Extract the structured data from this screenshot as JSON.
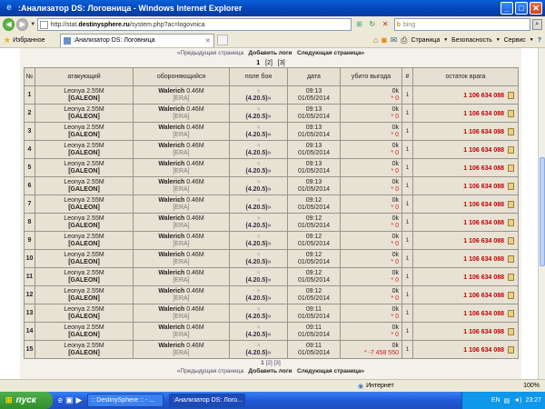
{
  "window": {
    "title": ":Анализатор DS: Логовница - Windows Internet Explorer",
    "min": "_",
    "max": "□",
    "close": "✕"
  },
  "address": {
    "prefix": "http://stat.",
    "domain": "destinysphere.ru",
    "path": "/system.php?ac=logovnica",
    "search_placeholder": "bing"
  },
  "favorites": {
    "label": "Избранное"
  },
  "tab": {
    "label": ":Анализатор DS: Логовница"
  },
  "commands": {
    "page": "Страница",
    "safety": "Безопасность",
    "service": "Сервис",
    "help": "?"
  },
  "pager": {
    "prev": "«Предыдущая страница",
    "add": "Добавить логи",
    "next": "Следующая страница»",
    "pages": [
      "1",
      "[2]",
      "[3]"
    ]
  },
  "table": {
    "headers": [
      "№",
      "атакующий",
      "обороняющийся",
      "поле боя",
      "дата",
      "убито выгода",
      "#",
      "остаток врага"
    ],
    "rows": [
      {
        "n": "1",
        "att": "Leonya 2.55M",
        "att_corp": "[GALEON]",
        "def": "Walerich",
        "def_val": "0.46M",
        "def_corp": "[ERA]",
        "field": "(4.20.5)",
        "time": "09:13",
        "date": "01/05/2014",
        "kill": "0k",
        "gain": "0",
        "hash": "1",
        "rest": "1 106 634 088"
      },
      {
        "n": "2",
        "att": "Leonya 2.55M",
        "att_corp": "[GALEON]",
        "def": "Walerich",
        "def_val": "0.46M",
        "def_corp": "[ERA]",
        "field": "(4.20.5)",
        "time": "09:13",
        "date": "01/05/2014",
        "kill": "0k",
        "gain": "0",
        "hash": "1",
        "rest": "1 106 634 088"
      },
      {
        "n": "3",
        "att": "Leonya 2.55M",
        "att_corp": "[GALEON]",
        "def": "Walerich",
        "def_val": "0.46M",
        "def_corp": "[ERA]",
        "field": "(4.20.5)",
        "time": "09:13",
        "date": "01/05/2014",
        "kill": "0k",
        "gain": "0",
        "hash": "1",
        "rest": "1 106 634 088"
      },
      {
        "n": "4",
        "att": "Leonya 2.55M",
        "att_corp": "[GALEON]",
        "def": "Walerich",
        "def_val": "0.46M",
        "def_corp": "[ERA]",
        "field": "(4.20.5)",
        "time": "09:13",
        "date": "01/05/2014",
        "kill": "0k",
        "gain": "0",
        "hash": "1",
        "rest": "1 106 634 088"
      },
      {
        "n": "5",
        "att": "Leonya 2.55M",
        "att_corp": "[GALEON]",
        "def": "Walerich",
        "def_val": "0.46M",
        "def_corp": "[ERA]",
        "field": "(4.20.5)",
        "time": "09:13",
        "date": "01/05/2014",
        "kill": "0k",
        "gain": "0",
        "hash": "1",
        "rest": "1 106 634 088"
      },
      {
        "n": "6",
        "att": "Leonya 2.55M",
        "att_corp": "[GALEON]",
        "def": "Walerich",
        "def_val": "0.46M",
        "def_corp": "[ERA]",
        "field": "(4.20.5)",
        "time": "09:13",
        "date": "01/05/2014",
        "kill": "0k",
        "gain": "0",
        "hash": "1",
        "rest": "1 106 634 088"
      },
      {
        "n": "7",
        "att": "Leonya 2.55M",
        "att_corp": "[GALEON]",
        "def": "Walerich",
        "def_val": "0.46M",
        "def_corp": "[ERA]",
        "field": "(4.20.5)",
        "time": "09:12",
        "date": "01/05/2014",
        "kill": "0k",
        "gain": "0",
        "hash": "1",
        "rest": "1 106 634 088"
      },
      {
        "n": "8",
        "att": "Leonya 2.55M",
        "att_corp": "[GALEON]",
        "def": "Walerich",
        "def_val": "0.46M",
        "def_corp": "[ERA]",
        "field": "(4.20.5)",
        "time": "09:12",
        "date": "01/05/2014",
        "kill": "0k",
        "gain": "0",
        "hash": "1",
        "rest": "1 106 634 088"
      },
      {
        "n": "9",
        "att": "Leonya 2.55M",
        "att_corp": "[GALEON]",
        "def": "Walerich",
        "def_val": "0.46M",
        "def_corp": "[ERA]",
        "field": "(4.20.5)",
        "time": "09:12",
        "date": "01/05/2014",
        "kill": "0k",
        "gain": "0",
        "hash": "1",
        "rest": "1 106 634 088"
      },
      {
        "n": "10",
        "att": "Leonya 2.55M",
        "att_corp": "[GALEON]",
        "def": "Walerich",
        "def_val": "0.46M",
        "def_corp": "[ERA]",
        "field": "(4.20.5)",
        "time": "09:12",
        "date": "01/05/2014",
        "kill": "0k",
        "gain": "0",
        "hash": "1",
        "rest": "1 106 634 088"
      },
      {
        "n": "11",
        "att": "Leonya 2.55M",
        "att_corp": "[GALEON]",
        "def": "Walerich",
        "def_val": "0.46M",
        "def_corp": "[ERA]",
        "field": "(4.20.5)",
        "time": "09:12",
        "date": "01/05/2014",
        "kill": "0k",
        "gain": "0",
        "hash": "1",
        "rest": "1 106 634 088"
      },
      {
        "n": "12",
        "att": "Leonya 2.55M",
        "att_corp": "[GALEON]",
        "def": "Walerich",
        "def_val": "0.46M",
        "def_corp": "[ERA]",
        "field": "(4.20.5)",
        "time": "09:12",
        "date": "01/05/2014",
        "kill": "0k",
        "gain": "0",
        "hash": "1",
        "rest": "1 106 634 088"
      },
      {
        "n": "13",
        "att": "Leonya 2.55M",
        "att_corp": "[GALEON]",
        "def": "Walerich",
        "def_val": "0.46M",
        "def_corp": "[ERA]",
        "field": "(4.20.5)",
        "time": "09:11",
        "date": "01/05/2014",
        "kill": "0k",
        "gain": "0",
        "hash": "1",
        "rest": "1 106 634 088"
      },
      {
        "n": "14",
        "att": "Leonya 2.55M",
        "att_corp": "[GALEON]",
        "def": "Walerich",
        "def_val": "0.46M",
        "def_corp": "[ERA]",
        "field": "(4.20.5)",
        "time": "09:11",
        "date": "01/05/2014",
        "kill": "0k",
        "gain": "0",
        "hash": "1",
        "rest": "1 106 634 088"
      },
      {
        "n": "15",
        "att": "Leonya 2.55M",
        "att_corp": "[GALEON]",
        "def": "Walerich",
        "def_val": "0.46M",
        "def_corp": "[ERA]",
        "field": "(4.20.5)",
        "time": "09:11",
        "date": "01/05/2014",
        "kill": "0k",
        "gain": "-7 458 550",
        "hash": "1",
        "rest": "1 106 634 088"
      }
    ]
  },
  "status": {
    "zone": "Интернет",
    "zoom": "100%"
  },
  "taskbar": {
    "start": "пуск",
    "items": [
      ":: DestinySphere :: - ...",
      ":Анализатор DS: Лого..."
    ],
    "lang": "EN",
    "clock": "23:27"
  },
  "colors": {
    "enemy_rest": "#c00000",
    "row_bg": "#e8e2d4"
  }
}
